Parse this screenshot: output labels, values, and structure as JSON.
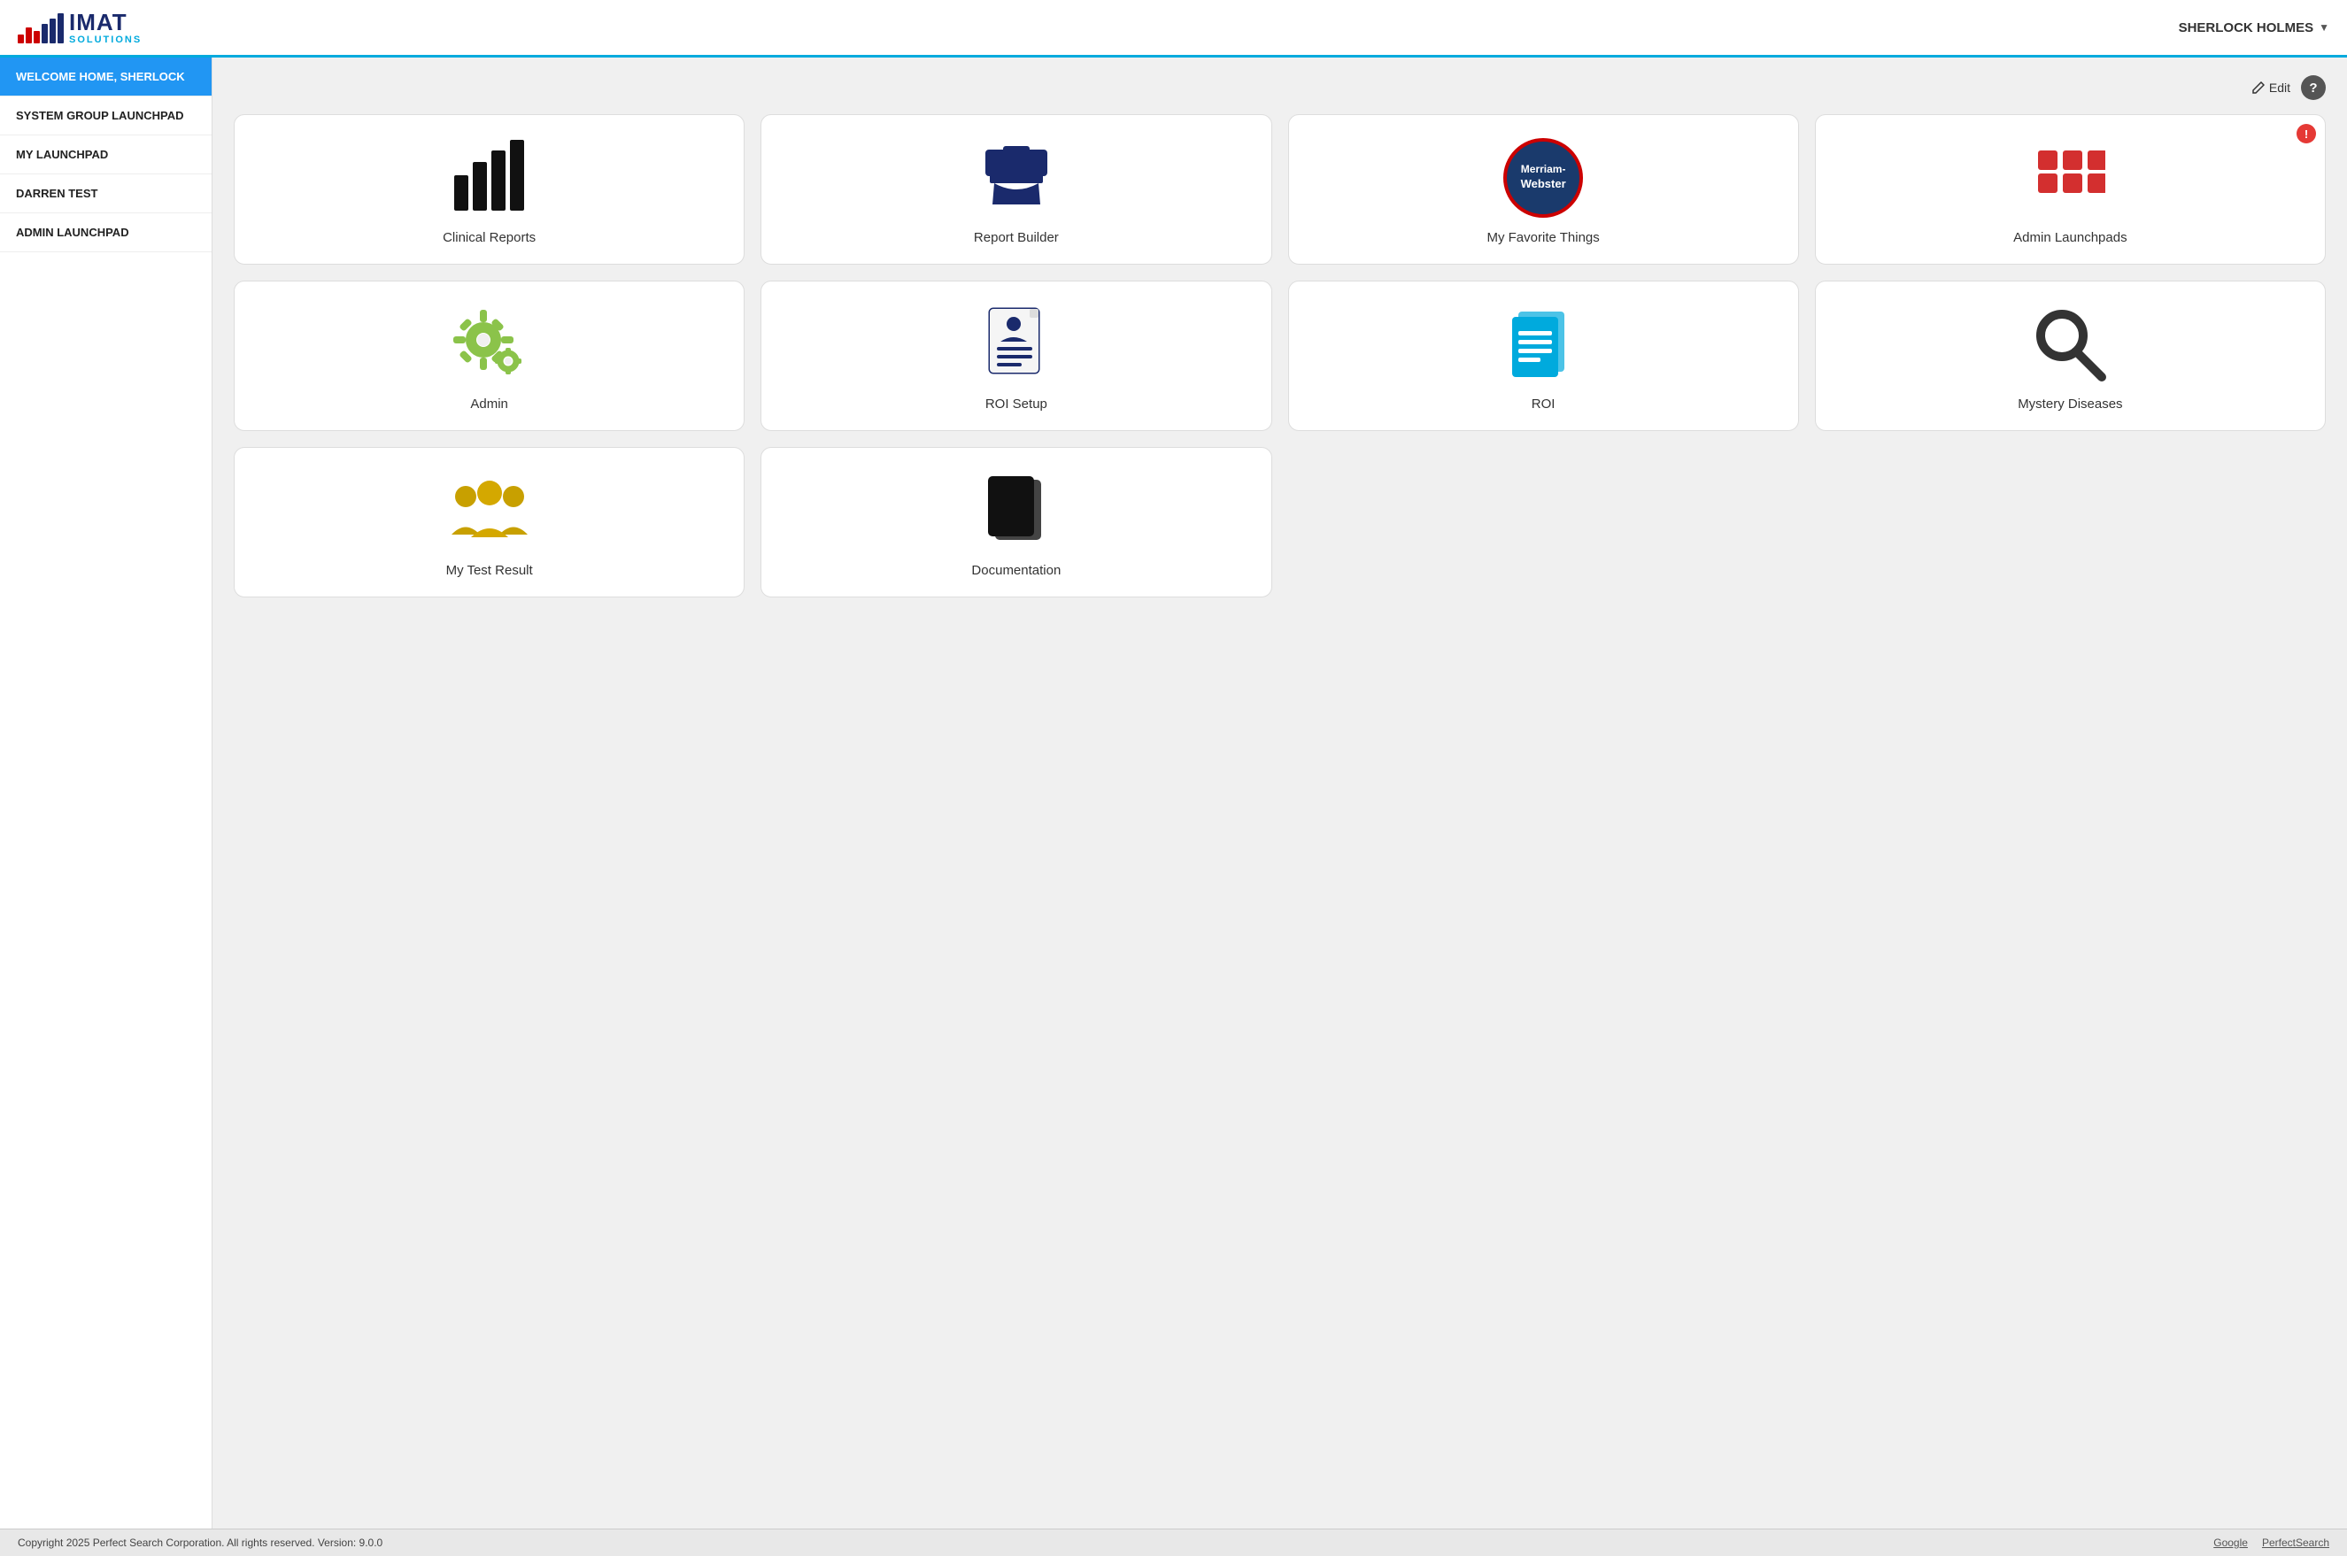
{
  "header": {
    "logo_text_imat": "IMAT",
    "logo_text_solutions": "SOLUTIONS",
    "user_name": "SHERLOCK HOLMES",
    "dropdown_symbol": "▼"
  },
  "sidebar": {
    "items": [
      {
        "id": "welcome",
        "label": "WELCOME HOME, SHERLOCK",
        "active": true
      },
      {
        "id": "system-group",
        "label": "SYSTEM GROUP LAUNCHPAD",
        "active": false
      },
      {
        "id": "my-launchpad",
        "label": "MY LAUNCHPAD",
        "active": false
      },
      {
        "id": "darren-test",
        "label": "DARREN TEST",
        "active": false
      },
      {
        "id": "admin-launchpad",
        "label": "ADMIN LAUNCHPAD",
        "active": false
      }
    ]
  },
  "toolbar": {
    "edit_label": "Edit",
    "help_label": "?"
  },
  "tiles": [
    {
      "id": "clinical-reports",
      "label": "Clinical Reports",
      "icon": "bar-chart",
      "badge": null
    },
    {
      "id": "report-builder",
      "label": "Report Builder",
      "icon": "anvil",
      "badge": null
    },
    {
      "id": "my-favorite-things",
      "label": "My Favorite Things",
      "icon": "merriam-webster",
      "badge": null
    },
    {
      "id": "admin-launchpads",
      "label": "Admin Launchpads",
      "icon": "grid-red",
      "badge": "!"
    },
    {
      "id": "admin",
      "label": "Admin",
      "icon": "gear",
      "badge": null
    },
    {
      "id": "roi-setup",
      "label": "ROI Setup",
      "icon": "roi-setup-doc",
      "badge": null
    },
    {
      "id": "roi",
      "label": "ROI",
      "icon": "roi-doc",
      "badge": null
    },
    {
      "id": "mystery-diseases",
      "label": "Mystery Diseases",
      "icon": "magnifier",
      "badge": null
    },
    {
      "id": "my-test-result",
      "label": "My Test Result",
      "icon": "users",
      "badge": null
    },
    {
      "id": "documentation",
      "label": "Documentation",
      "icon": "doc-stack",
      "badge": null
    }
  ],
  "footer": {
    "copyright": "Copyright 2025 Perfect Search Corporation. All rights reserved. Version: 9.0.0",
    "links": [
      {
        "id": "google",
        "label": "Google"
      },
      {
        "id": "perfectsearch",
        "label": "PerfectSearch"
      }
    ]
  }
}
